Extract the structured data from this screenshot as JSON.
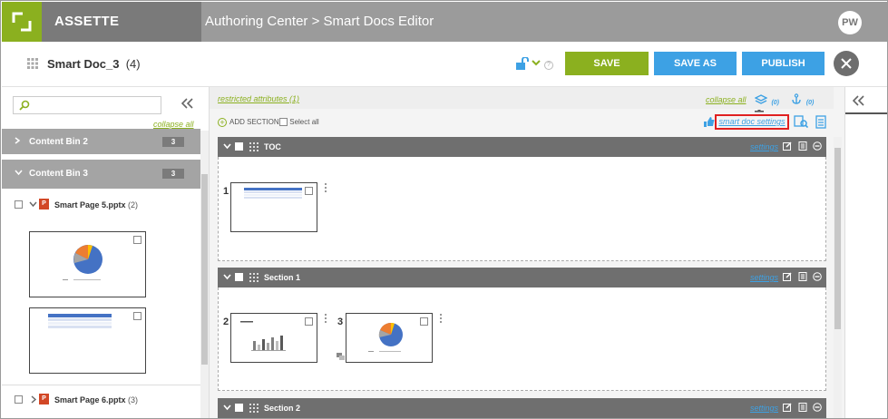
{
  "app": {
    "brand": "ASSETTE",
    "breadcrumb": "Authoring Center > Smart Docs Editor",
    "avatar": "PW"
  },
  "doc": {
    "title": "Smart Doc_3",
    "count": "(4)"
  },
  "buttons": {
    "save": "SAVE",
    "save_as": "SAVE AS",
    "publish": "PUBLISH"
  },
  "left_panel": {
    "search_placeholder": "",
    "collapse_all": "collapse all",
    "bins": [
      {
        "label": "Content Bin 2",
        "count": "3"
      },
      {
        "label": "Content Bin 3",
        "count": "3"
      }
    ],
    "pages": [
      {
        "name": "Smart Page 5.pptx",
        "count": "(2)"
      },
      {
        "name": "Smart Page 6.pptx",
        "count": "(3)"
      }
    ],
    "pptx_letter": "P"
  },
  "main": {
    "restricted_attributes": "restricted attributes (1)",
    "collapse_all": "collapse all",
    "layers_count": "(0)",
    "anchor_count": "(0)",
    "add_section": "ADD SECTION",
    "select_all": "Select all",
    "smart_doc_settings": "smart doc settings",
    "sections": [
      {
        "name": "TOC",
        "settings": "settings",
        "slides": [
          "1"
        ]
      },
      {
        "name": "Section 1",
        "settings": "settings",
        "slides": [
          "2",
          "3"
        ]
      },
      {
        "name": "Section 2",
        "settings": "settings",
        "slides": []
      }
    ]
  },
  "colors": {
    "green": "#8bb01f",
    "blue": "#3da1e4",
    "red_highlight": "#e02020",
    "topbar": "#9b9b9b"
  }
}
